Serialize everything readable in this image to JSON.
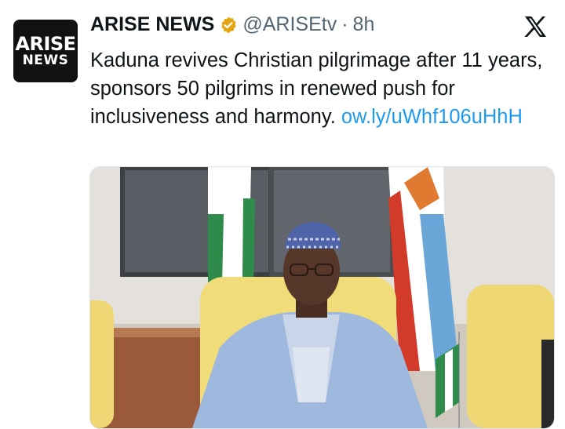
{
  "avatar": {
    "line1": "ARISE",
    "line2": "NEWS"
  },
  "author": {
    "name": "ARISE NEWS",
    "handle": "@ARISEtv",
    "separator": "·",
    "time": "8h",
    "verified_badge_color": "#e2a712"
  },
  "tweet": {
    "text": "Kaduna revives Christian pilgrimage after 11 years, sponsors 50 pilgrims in renewed push for inclusiveness and harmony. ",
    "link": "ow.ly/uWhf106uHhH"
  },
  "icons": {
    "platform": "x-logo-icon",
    "verified": "verified-badge-icon"
  },
  "colors": {
    "link": "#1d9bf0",
    "secondary_text": "#536471"
  }
}
